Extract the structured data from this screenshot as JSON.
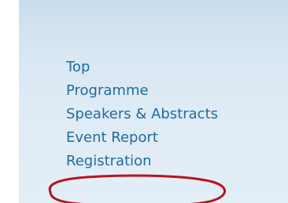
{
  "nav": {
    "items": [
      {
        "label": "Top"
      },
      {
        "label": "Programme"
      },
      {
        "label": "Speakers & Abstracts"
      },
      {
        "label": "Event Report"
      },
      {
        "label": "Registration"
      }
    ]
  },
  "colors": {
    "link": "#1f6aa8",
    "highlight_ring": "#b8141e",
    "panel": "#d7e6f2"
  },
  "highlighted_item": "Registration"
}
